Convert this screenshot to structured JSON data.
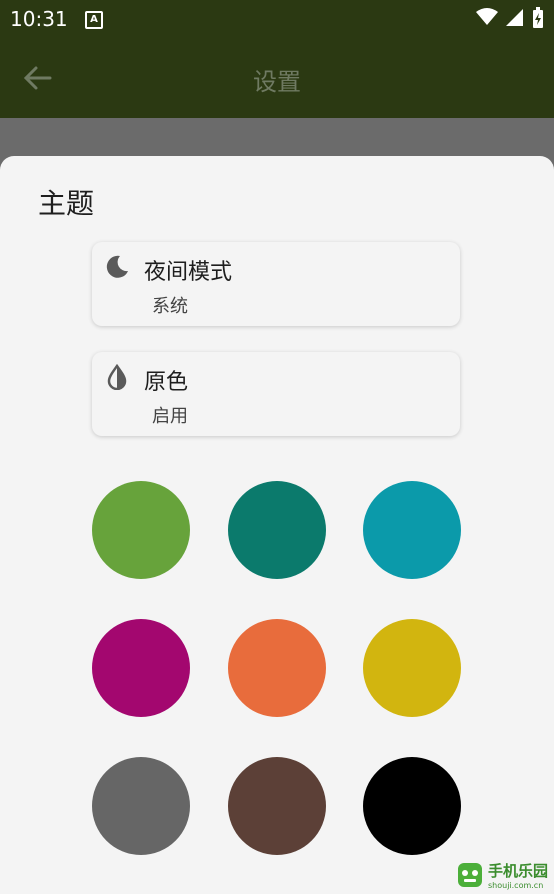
{
  "status_bar": {
    "time": "10:31",
    "notification_letter": "A"
  },
  "app_bar": {
    "title": "设置"
  },
  "sheet": {
    "title": "主题",
    "options": [
      {
        "title": "夜间模式",
        "value": "系统",
        "icon": "moon-icon"
      },
      {
        "title": "原色",
        "value": "启用",
        "icon": "contrast-icon"
      }
    ],
    "swatches": [
      {
        "name": "green",
        "color": "#67a33b"
      },
      {
        "name": "teal",
        "color": "#0b7a6c"
      },
      {
        "name": "cyan",
        "color": "#0b9aaa"
      },
      {
        "name": "magenta",
        "color": "#a3076f"
      },
      {
        "name": "orange",
        "color": "#e86c3c"
      },
      {
        "name": "mustard",
        "color": "#d2b50f"
      },
      {
        "name": "gray",
        "color": "#666666"
      },
      {
        "name": "brown",
        "color": "#5c4037"
      },
      {
        "name": "black",
        "color": "#000000"
      }
    ]
  },
  "watermark": {
    "text": "手机乐园",
    "sub": "shouji.com.cn"
  }
}
